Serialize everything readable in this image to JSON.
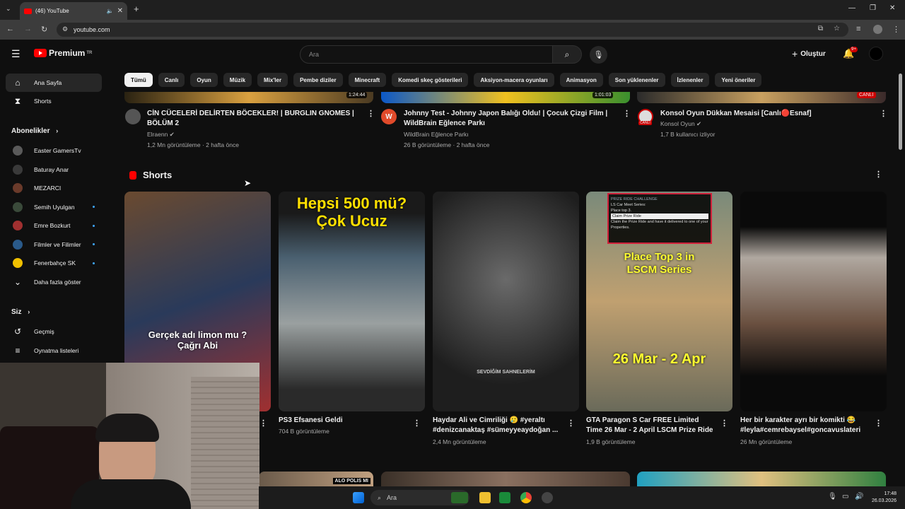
{
  "browser": {
    "tab_title": "(46) YouTube",
    "url": "youtube.com"
  },
  "youtube": {
    "logo_text": "Premium",
    "logo_region": "TR",
    "search_placeholder": "Ara",
    "create_label": "Oluştur",
    "notif_count": "9+"
  },
  "chips": [
    "Tümü",
    "Canlı",
    "Oyun",
    "Müzik",
    "Mix'ler",
    "Pembe diziler",
    "Minecraft",
    "Komedi skeç gösterileri",
    "Aksiyon-macera oyunları",
    "Animasyon",
    "Son yüklenenler",
    "İzlenenler",
    "Yeni öneriler"
  ],
  "sidebar": {
    "home": "Ana Sayfa",
    "shorts": "Shorts",
    "subscriptions_header": "Abonelikler",
    "subscriptions": [
      {
        "name": "Easter GamersTv",
        "dot": false
      },
      {
        "name": "Baturay Anar",
        "dot": false
      },
      {
        "name": "MEZARCI",
        "dot": false
      },
      {
        "name": "Semih Uyulgan",
        "dot": true
      },
      {
        "name": "Emre Bozkurt",
        "dot": true
      },
      {
        "name": "Filmler ve Filimler",
        "dot": true
      },
      {
        "name": "Fenerbahçe SK",
        "dot": true
      }
    ],
    "show_more": "Daha fazla göster",
    "you_header": "Siz",
    "history": "Geçmiş",
    "playlists": "Oynatma listeleri"
  },
  "videos": [
    {
      "duration": "1:24:44",
      "title1": "CİN CÜCELERİ DELİRTEN BÖCEKLER! | BURGLIN GNOMES |",
      "title2": "BÖLÜM 2",
      "channel": "Elraenn ✔",
      "meta": "1,2 Mn görüntüleme · 2 hafta önce"
    },
    {
      "duration": "1:01:03",
      "title1": "Johnny Test - Johnny Japon Balığı Oldu! | Çocuk Çizgi Film |",
      "title2": "WildBrain Eğlence Parkı",
      "channel": "WildBrain Eğlence Parkı",
      "meta": "26 B görüntüleme · 2 hafta önce"
    },
    {
      "duration": "CANLI",
      "title1": "Konsol Oyun Dükkan Mesaisi [Canlı🔴Esnaf]",
      "title2": "",
      "channel": "Konsol Oyun ✔",
      "meta": "1,7 B kullanıcı izliyor",
      "avatar_badge": "CANLI"
    }
  ],
  "shorts": {
    "header": "Shorts",
    "items": [
      {
        "overlay": "Gerçek adı limon mu ?\nÇağrı Abi",
        "title1": "",
        "title2": "",
        "views": ""
      },
      {
        "overlay": "Hepsi 500 mü?\nÇok Ucuz",
        "title1": "PS3 Efsanesi Geldi",
        "title2": "",
        "views": "704 B görüntüleme"
      },
      {
        "overlay": "SEVDİĞİM SAHNELERİM",
        "title1": "Haydar Ali ve Cimriliği 🥲 #yeraltı",
        "title2": "#denizcanaktaş #sümeyyeaydoğan ...",
        "views": "2,4 Mn görüntüleme"
      },
      {
        "overlay": "Place Top 3 in\nLSCM Series",
        "overlay2": "26 Mar - 2 Apr",
        "title1": "GTA Paragon S Car FREE Limited",
        "title2": "Time 26 Mar - 2 April LSCM Prize Ride",
        "views": "1,9 B görüntüleme"
      },
      {
        "overlay": "",
        "title1": "Her bir karakter ayrı bir komikti 😂",
        "title2": "#leyla#cemrebaysel#goncavuslateri",
        "views": "26 Mn görüntüleme"
      }
    ],
    "gta_panel": [
      "PRIZE RIDE CHALLENGE",
      "LS Car Meet Series:",
      "Place top 3.",
      "Claim Prize Ride",
      "Claim the Prize Ride and have it delivered to one of your Properties."
    ]
  },
  "bottom_thumb_label": "ALO POLIS MI",
  "taskbar": {
    "search": "Ara",
    "time": "17:48",
    "date": "26.03.2026"
  }
}
